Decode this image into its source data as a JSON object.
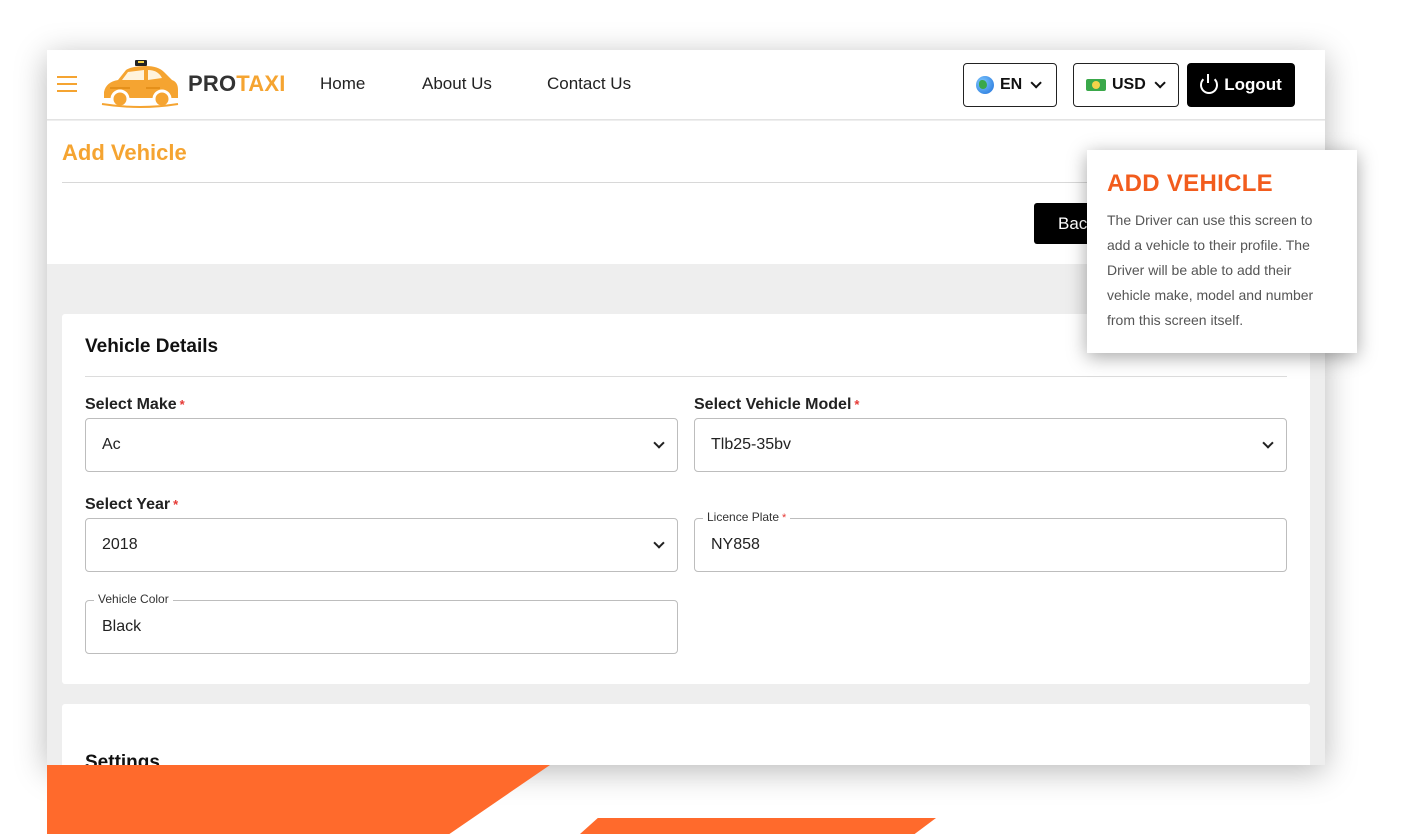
{
  "brand": {
    "pro": "PRO",
    "taxi": "TAXI"
  },
  "nav": {
    "home": "Home",
    "about": "About Us",
    "contact": "Contact Us"
  },
  "language": {
    "label": "EN"
  },
  "currency": {
    "label": "USD"
  },
  "logout_label": "Logout",
  "page": {
    "title": "Add Vehicle",
    "back_label": "Back"
  },
  "vehicle_details": {
    "heading": "Vehicle Details",
    "make": {
      "label": "Select Make",
      "required": "*",
      "value": "Ac"
    },
    "model": {
      "label": "Select Vehicle Model",
      "required": "*",
      "value": "Tlb25-35bv"
    },
    "year": {
      "label": "Select Year",
      "required": "*",
      "value": "2018"
    },
    "plate": {
      "label": "Licence Plate",
      "required": "*",
      "value": "NY858"
    },
    "color": {
      "label": "Vehicle Color",
      "value": "Black"
    }
  },
  "settings": {
    "heading": "Settings"
  },
  "callout": {
    "title": "ADD VEHICLE",
    "body": "The Driver can use this screen to add a vehicle to their profile. The Driver will be able to add their vehicle make, model and number from this screen itself."
  },
  "colors": {
    "accent": "#f5a431",
    "callout_title": "#f25c1d",
    "decor": "#ff6a2c"
  }
}
